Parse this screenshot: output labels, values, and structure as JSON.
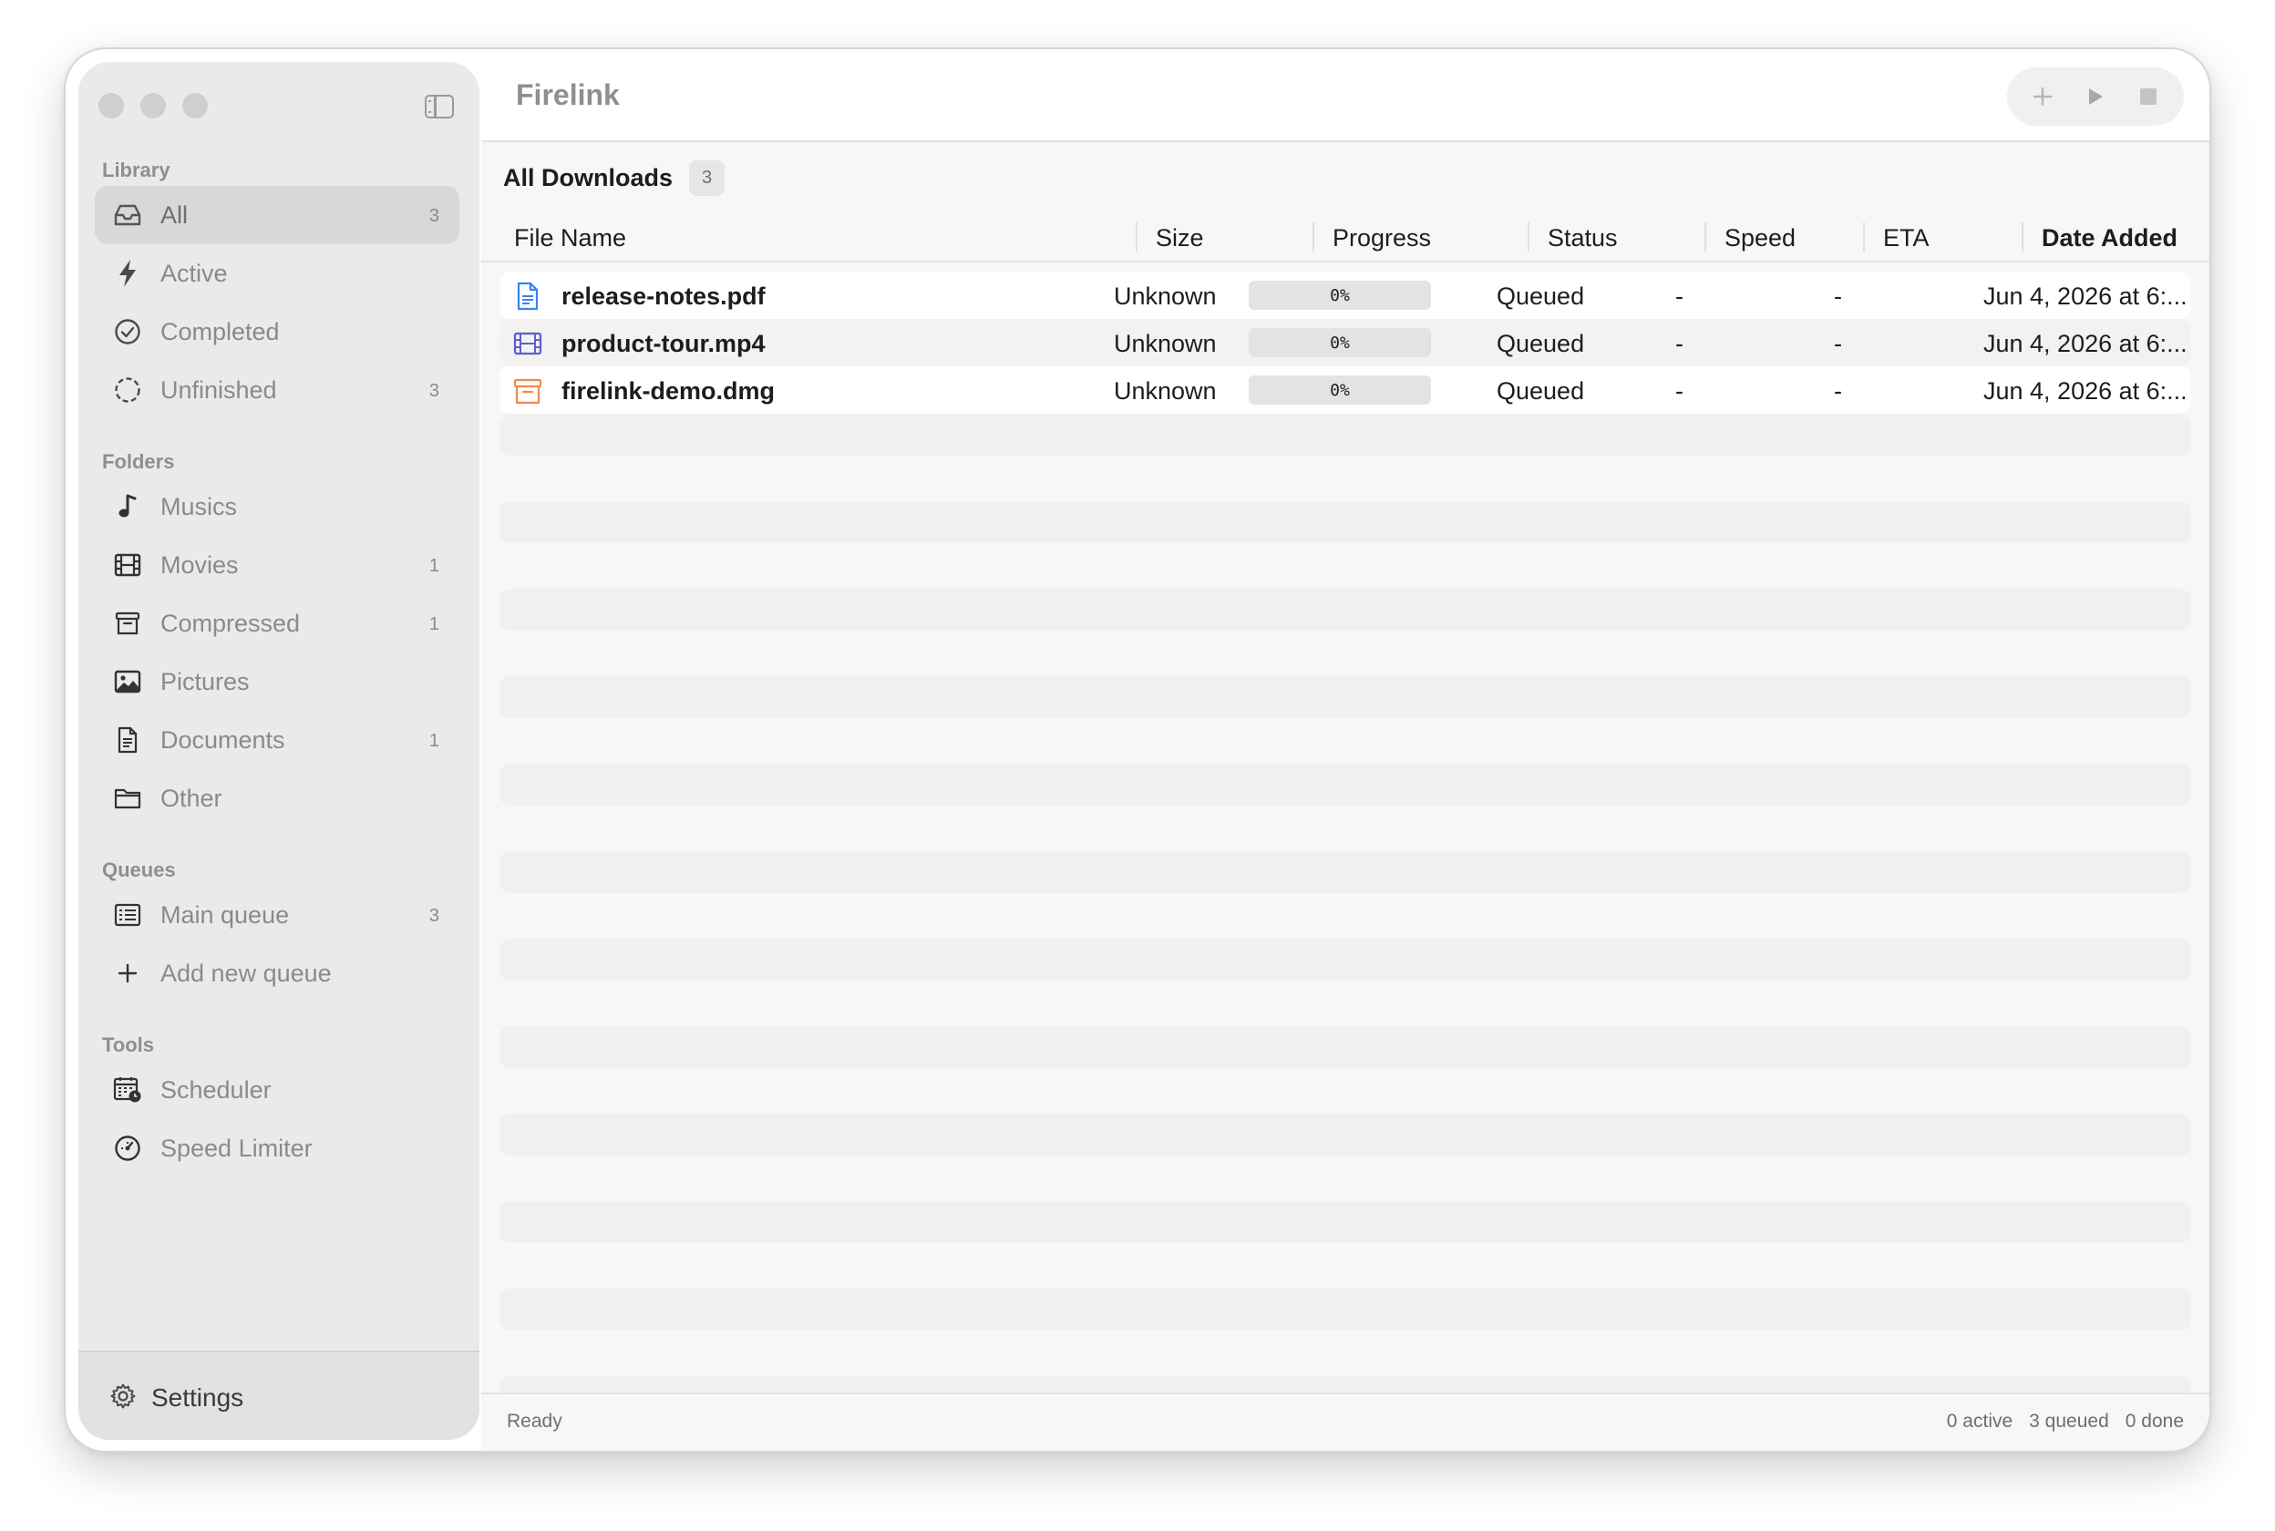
{
  "window": {
    "app_title": "Firelink"
  },
  "sidebar": {
    "sections": {
      "library": "Library",
      "folders": "Folders",
      "queues": "Queues",
      "tools": "Tools"
    },
    "library": [
      {
        "label": "All",
        "count": "3",
        "icon": "tray-icon",
        "selected": true
      },
      {
        "label": "Active",
        "count": "",
        "icon": "bolt-icon"
      },
      {
        "label": "Completed",
        "count": "",
        "icon": "checkmark-circle-icon"
      },
      {
        "label": "Unfinished",
        "count": "3",
        "icon": "dashed-circle-icon"
      }
    ],
    "folders": [
      {
        "label": "Musics",
        "count": "",
        "icon": "music-note-icon"
      },
      {
        "label": "Movies",
        "count": "1",
        "icon": "film-icon"
      },
      {
        "label": "Compressed",
        "count": "1",
        "icon": "archive-box-icon"
      },
      {
        "label": "Pictures",
        "count": "",
        "icon": "photo-icon"
      },
      {
        "label": "Documents",
        "count": "1",
        "icon": "document-icon"
      },
      {
        "label": "Other",
        "count": "",
        "icon": "folder-icon"
      }
    ],
    "queues": [
      {
        "label": "Main queue",
        "count": "3",
        "icon": "list-icon"
      },
      {
        "label": "Add new queue",
        "count": "",
        "icon": "plus-icon"
      }
    ],
    "tools": [
      {
        "label": "Scheduler",
        "count": "",
        "icon": "calendar-clock-icon"
      },
      {
        "label": "Speed Limiter",
        "count": "",
        "icon": "speedometer-icon"
      }
    ],
    "settings_label": "Settings"
  },
  "main": {
    "list_title": "All Downloads",
    "list_count": "3",
    "columns": [
      "File Name",
      "Size",
      "Progress",
      "Status",
      "Speed",
      "ETA",
      "Date Added"
    ],
    "sorted_column": "Date Added",
    "rows": [
      {
        "name": "release-notes.pdf",
        "icon": "document-icon",
        "size": "Unknown",
        "progress": 0,
        "progress_label": "0%",
        "status": "Queued",
        "speed": "-",
        "eta": "-",
        "date": "Jun 4, 2026 at 6:..."
      },
      {
        "name": "product-tour.mp4",
        "icon": "film-icon",
        "size": "Unknown",
        "progress": 0,
        "progress_label": "0%",
        "status": "Queued",
        "speed": "-",
        "eta": "-",
        "date": "Jun 4, 2026 at 6:..."
      },
      {
        "name": "firelink-demo.dmg",
        "icon": "archive-box-icon",
        "size": "Unknown",
        "progress": 0,
        "progress_label": "0%",
        "status": "Queued",
        "speed": "-",
        "eta": "-",
        "date": "Jun 4, 2026 at 6:..."
      }
    ]
  },
  "status_bar": {
    "left": "Ready",
    "active": "0 active",
    "queued": "3 queued",
    "done": "0 done"
  },
  "colors": {
    "doc_icon": "#3b82f6",
    "film_icon": "#5b5fc7",
    "archive_icon": "#f08a4b",
    "progress_fill": "#3a82f6"
  }
}
